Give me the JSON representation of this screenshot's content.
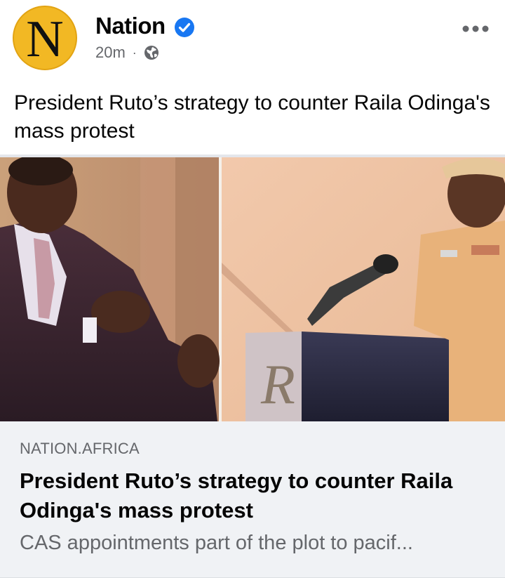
{
  "header": {
    "avatar_letter": "N",
    "page_name": "Nation",
    "timestamp": "20m",
    "separator": "·",
    "privacy_icon": "globe-icon",
    "verified_icon": "verified-badge-icon",
    "more_icon": "more-options-icon"
  },
  "post": {
    "text": "President Ruto’s strategy to counter Raila Odinga's mass protest"
  },
  "link_preview": {
    "domain": "NATION.AFRICA",
    "title": "President Ruto’s strategy to counter Raila Odinga's mass protest",
    "description": "CAS appointments part of the plot to pacif..."
  },
  "colors": {
    "avatar_bg": "#f2b824",
    "verified_blue": "#1877f2",
    "meta_gray": "#65676b",
    "link_bg": "#f0f2f5"
  }
}
